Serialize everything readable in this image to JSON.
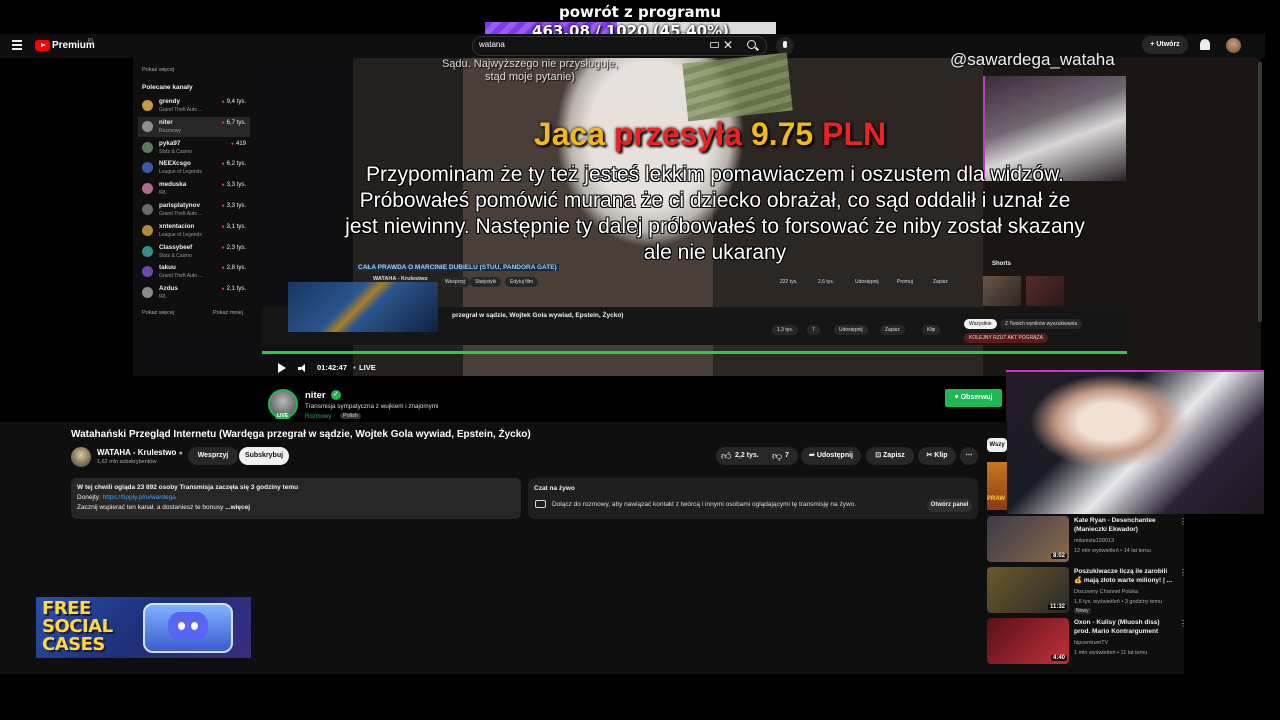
{
  "overlay": {
    "title": "powrót z programu",
    "progress_text": "463.08 / 1020 (45.40%)",
    "progress_fraction": 0.454
  },
  "header": {
    "brand": "Premium",
    "brand_region": "PL",
    "search_value": "watana",
    "create_label": "Utwórz"
  },
  "stream": {
    "top_caption": "Sądu. Najwyższego nie przysługuje, stąd moje pytanie)",
    "handle": "@sawardega_wataha",
    "donation_name": "Jaca",
    "donation_verb": "przesyła",
    "donation_amount": "9.75",
    "donation_currency": "PLN",
    "donation_message": "Przypominam że ty też jesteś lekkim pomawiaczem i oszustem dla widzów. Próbowałeś pomówić murana że ci dziecko obrażał, co sąd oddalił i uznał że jest niewinny. Następnie ty dalej próbowałeś to forsować że niby został skazany ale nie ukarany",
    "inner_title": "CAŁA PRAWDA O MARCINIE DUBIELU (STUU, PANDORA GATE)",
    "inner_channel": "WATAHA - Krulestwo",
    "inner_pills": [
      "Wesprzyj",
      "Statystyki",
      "Edytuj film"
    ],
    "inner_actions": [
      "222 tys.",
      "2,6 tys.",
      "Udostępnij",
      "Promuj",
      "Zapisz"
    ],
    "inner_title2": "przegrał w sądzie, Wojtek Gola wywiad, Epstein, Życko)",
    "inner_actions2": [
      "1,3 tys.",
      "7",
      "Udostępnij",
      "Zapisz",
      "Klip"
    ],
    "inner_chips": [
      "Wszystkie",
      "Z Twoich wyników wyszukiwania"
    ],
    "shorts_label": "Shorts",
    "headline_bottom": "KOLEJNY RZUT AKT POGRĄŻA"
  },
  "side_panel": {
    "more_top": "Pokaż więcej",
    "heading": "Polecane kanały",
    "channels": [
      {
        "name": "grendy",
        "category": "Grand Theft Auto ...",
        "count": "9,4 tys.",
        "color": "#c89b3c"
      },
      {
        "name": "niter",
        "category": "Rozmowy",
        "count": "6,7 tys.",
        "color": "#8f8f8f"
      },
      {
        "name": "pyka97",
        "category": "Slots & Casino",
        "count": "419",
        "color": "#5a7d5a"
      },
      {
        "name": "NEEXcsgo",
        "category": "League of Legends",
        "count": "6,2 tys.",
        "color": "#3b5ba8"
      },
      {
        "name": "meduska",
        "category": "IRL",
        "count": "3,3 tys.",
        "color": "#b06a8c"
      },
      {
        "name": "parisplatynov",
        "category": "Grand Theft Auto ...",
        "count": "3,3 tys.",
        "color": "#6a6a6a"
      },
      {
        "name": "xntentacion",
        "category": "League of Legends",
        "count": "3,1 tys.",
        "color": "#b08a3c"
      },
      {
        "name": "Classybeef",
        "category": "Slots & Casino",
        "count": "2,3 tys.",
        "color": "#3c8a8a"
      },
      {
        "name": "takuu",
        "category": "Grand Theft Auto ...",
        "count": "2,8 tys.",
        "color": "#6a4ab0"
      },
      {
        "name": "Azdus",
        "category": "IRL",
        "count": "2,1 tys.",
        "color": "#8a8a8a"
      }
    ],
    "more_bottom": "Pokaż więcej",
    "less": "Pokaż mniej"
  },
  "controls": {
    "time": "01:42:47",
    "live": "LIVE"
  },
  "streamer": {
    "name": "niter",
    "live_badge": "LIVE",
    "description": "Transmisja sympatyczna z wujkiem i znajomymi",
    "category": "Rozmowy",
    "language": "Polish",
    "follow_label": "Obserwuj"
  },
  "video": {
    "title": "Watahański Przegląd Internetu (Wardęga przegrał w sądzie, Wojtek Gola wywiad, Epstein, Życko)",
    "owner": "WATAHA - Krulestwo",
    "subscribers": "1,62 mln subskrybentów",
    "support_label": "Wesprzyj",
    "subscribe_label": "Subskrybuj",
    "likes": "2,2 tys.",
    "dislikes": "7",
    "share_label": "Udostępnij",
    "save_label": "Zapisz",
    "clip_label": "Klip",
    "more_label": "⋯"
  },
  "description": {
    "line1": "W tej chwili ogląda 23 892 osoby  Transmisja zaczęła się 3 godziny temu",
    "line2_prefix": "Donejty: ",
    "line2_link": "https://tipply.pl/u/wardega",
    "line3": "Zacznij wspierać ten kanał, a dostaniesz te bonusy",
    "more": "...więcej"
  },
  "chat": {
    "title": "Czat na żywo",
    "text": "Dołącz do rozmowy, aby nawiązać kontakt z twórcą i innymi osobami oglądającymi tę transmisję na żywo.",
    "open_label": "Otwórz panel"
  },
  "ad": {
    "line1": "FREE",
    "line2": "SOCIAL",
    "line3": "CASES"
  },
  "recommended": {
    "chip": "Wszy",
    "partial_label": "PRAW",
    "items": [
      {
        "title": "Kate Ryan - Desenchantee (Manieczki Ekwador)",
        "channel": "milanista199013",
        "meta": "12 mln wyświetleń • 14 lat temu",
        "duration": "8:02",
        "new": "",
        "color1": "#3a3a4a",
        "color2": "#8a6a4a"
      },
      {
        "title": "Poszukiwacze liczą ile zarobili 💰 mają złoto warte miliony! | ...",
        "channel": "Discovery Channel Polska",
        "meta": "1,6 tys. wyświetleń • 3 godziny temu",
        "duration": "11:32",
        "new": "Nowy",
        "color1": "#6a5a2a",
        "color2": "#2a2a2a"
      },
      {
        "title": "Oxon - Kulisy (Mluosh diss) prod. Mario Kontrargument",
        "channel": "hipcentrumTV",
        "meta": "1 mln wyświetleń • 11 lat temu",
        "duration": "4:40",
        "new": "",
        "color1": "#5a1018",
        "color2": "#c0303a"
      }
    ]
  }
}
